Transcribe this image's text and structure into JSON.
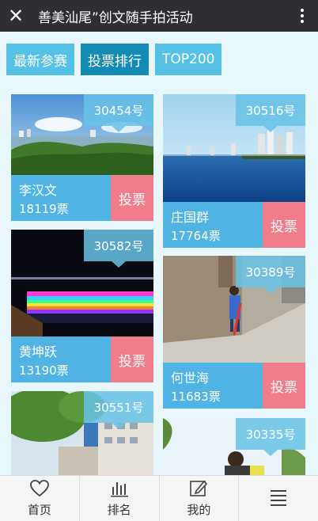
{
  "header": {
    "close_icon": "close-icon",
    "title": "善美汕尾”创文随手拍活动",
    "more_icon": "more-vertical-icon"
  },
  "tabs": [
    {
      "label": "最新参赛",
      "active": false
    },
    {
      "label": "投票排行",
      "active": true
    },
    {
      "label": "TOP200",
      "active": false
    }
  ],
  "entries": [
    {
      "id": "30454号",
      "name": "李汉文",
      "votes": "18119票",
      "vote_label": "投票",
      "photo": "coastal town with green trees"
    },
    {
      "id": "30516号",
      "name": "庄国群",
      "votes": "17764票",
      "vote_label": "投票",
      "photo": "city skyline across a bay"
    },
    {
      "id": "30582号",
      "name": "黄坤跃",
      "votes": "13190票",
      "vote_label": "投票",
      "photo": "rainbow-lit bridge at night"
    },
    {
      "id": "30389号",
      "name": "何世海",
      "votes": "11683票",
      "vote_label": "投票",
      "photo": "child sweeping a street"
    },
    {
      "id": "30551号",
      "name": "",
      "votes": "",
      "vote_label": "",
      "photo": "trees and apartment buildings"
    },
    {
      "id": "30335号",
      "name": "",
      "votes": "",
      "vote_label": "",
      "photo": "person cleaning under sky"
    }
  ],
  "bottom_nav": [
    {
      "label": "首页",
      "icon": "heart-icon"
    },
    {
      "label": "排名",
      "icon": "bar-chart-icon"
    },
    {
      "label": "我的",
      "icon": "edit-icon"
    },
    {
      "label": "",
      "icon": "menu-icon"
    }
  ],
  "colors": {
    "topbar": "#2f2f33",
    "tab": "#56c1e6",
    "tab_active": "#138bb5",
    "info": "#4fb3e3",
    "vote_button": "#f27d8a",
    "background": "#e8f7fb"
  }
}
